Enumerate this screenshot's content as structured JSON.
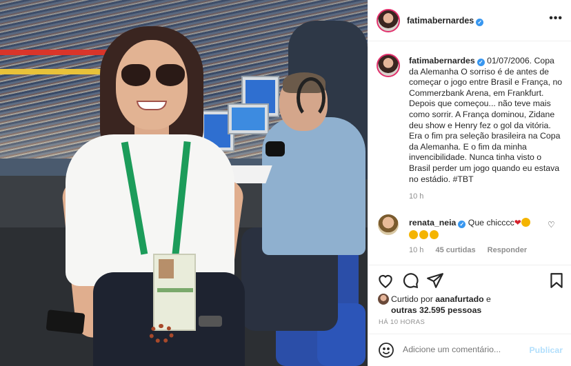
{
  "post": {
    "username": "fatimabernardes",
    "verified_mark": "✓",
    "more_label": "•••"
  },
  "caption": {
    "username": "fatimabernardes",
    "text": "01/07/2006. Copa da Alemanha O sorriso é de antes de começar o jogo entre Brasil e França, no Commerzbank Arena, em Frankfurt. Depois que começou... não teve mais como sorrir. A França dominou, Zidane deu show e Henry fez o gol da vitória. Era o fim pra seleção brasileira na Copa da Alemanha. E o fim da minha invencibilidade. Nunca tinha visto o Brasil perder um jogo quando eu estava no estádio. #TBT",
    "time": "10 h"
  },
  "comment": {
    "username": "renata_neia",
    "text": "Que chicccc",
    "time": "10 h",
    "likes": "45 curtidas",
    "reply_label": "Responder"
  },
  "likes": {
    "prefix": "Curtido por ",
    "user": "aanafurtado",
    "middle": " e",
    "others": "outras 32.595 pessoas"
  },
  "timestamp": "HÁ 10 HORAS",
  "add_comment": {
    "placeholder": "Adicione um comentário...",
    "publish_label": "Publicar"
  },
  "colors": {
    "verified": "#3897f0",
    "publish_disabled": "#b2dffc",
    "story_ring": "#e1306c"
  },
  "icons": [
    "heart-icon",
    "comment-icon",
    "share-icon",
    "bookmark-icon",
    "smiley-icon",
    "more-icon"
  ]
}
